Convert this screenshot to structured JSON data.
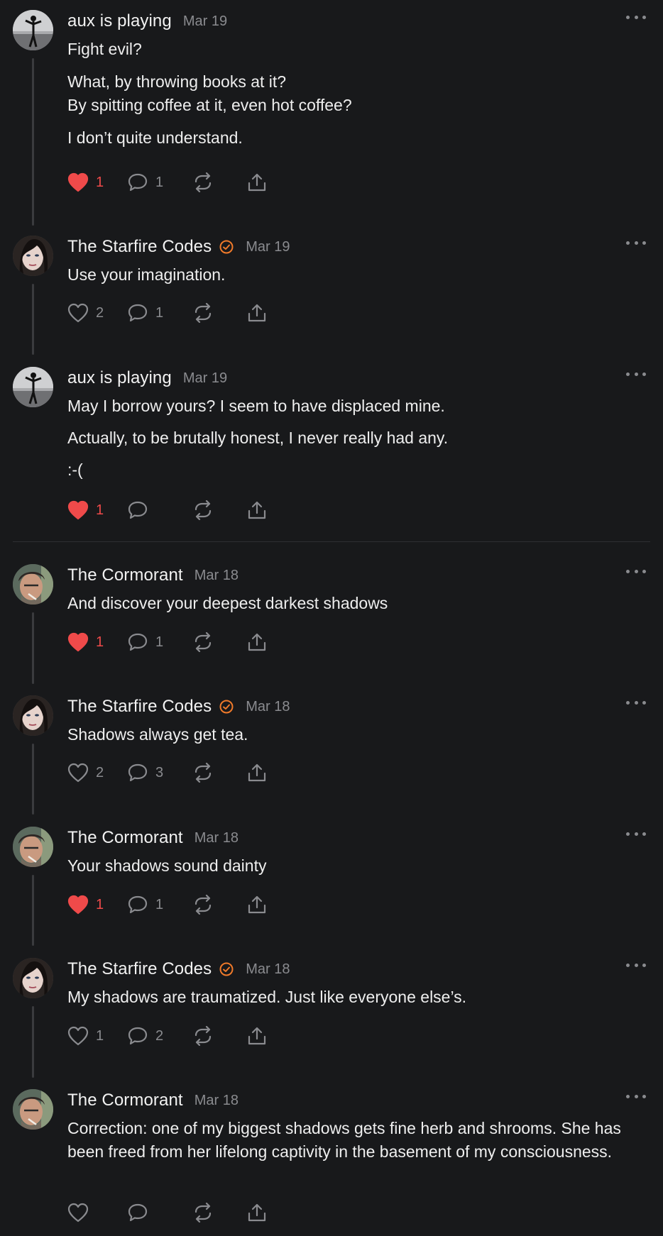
{
  "colors": {
    "background": "#18191b",
    "like": "#ef4a4a",
    "verified": "#f07a2a",
    "muted": "#8a8b8f"
  },
  "posts": [
    {
      "author": "aux is playing",
      "date": "Mar 19",
      "avatar": "silhouette-avatar",
      "verified": false,
      "lines": [
        "Fight evil?",
        "What, by throwing books at it?",
        "By spitting coffee at it, even hot coffee?",
        "I don’t quite understand."
      ],
      "likes": "1",
      "liked": true,
      "comments": "1"
    },
    {
      "author": "The Starfire Codes",
      "date": "Mar 19",
      "avatar": "woman-avatar",
      "verified": true,
      "lines": [
        "Use your imagination."
      ],
      "likes": "2",
      "liked": false,
      "comments": "1"
    },
    {
      "author": "aux is playing",
      "date": "Mar 19",
      "avatar": "silhouette-avatar",
      "verified": false,
      "lines": [
        "May I borrow yours? I seem to have displaced mine.",
        "Actually, to be brutally honest, I never really had any.",
        ":-("
      ],
      "likes": "1",
      "liked": true,
      "comments": ""
    },
    {
      "author": "The Cormorant",
      "date": "Mar 18",
      "avatar": "man-avatar",
      "verified": false,
      "lines": [
        "And discover your deepest darkest shadows"
      ],
      "likes": "1",
      "liked": true,
      "comments": "1"
    },
    {
      "author": "The Starfire Codes",
      "date": "Mar 18",
      "avatar": "woman-avatar",
      "verified": true,
      "lines": [
        "Shadows always get tea."
      ],
      "likes": "2",
      "liked": false,
      "comments": "3"
    },
    {
      "author": "The Cormorant",
      "date": "Mar 18",
      "avatar": "man-avatar",
      "verified": false,
      "lines": [
        "Your shadows sound dainty"
      ],
      "likes": "1",
      "liked": true,
      "comments": "1"
    },
    {
      "author": "The Starfire Codes",
      "date": "Mar 18",
      "avatar": "woman-avatar",
      "verified": true,
      "lines": [
        "My shadows are traumatized. Just like everyone else’s."
      ],
      "likes": "1",
      "liked": false,
      "comments": "2"
    },
    {
      "author": "The Cormorant",
      "date": "Mar 18",
      "avatar": "man-avatar",
      "verified": false,
      "lines": [
        "Correction: one of my biggest shadows gets fine herb and shrooms. She has been freed from her lifelong captivity in the basement of my consciousness."
      ],
      "likes": "",
      "liked": false,
      "comments": ""
    }
  ]
}
